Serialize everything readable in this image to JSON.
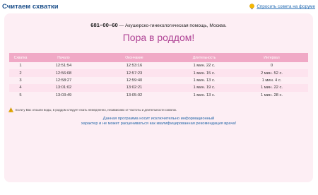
{
  "header": {
    "title": "Считаем схватки",
    "ask_link": "Спросить совета на форуме"
  },
  "panel": {
    "phone": "681−00−60",
    "phone_desc": "— Акушерско-гинекологическая помощь, Москва.",
    "headline": "Пора в роддом!",
    "columns": [
      "Схватка",
      "Начало",
      "Окончание",
      "Длительность",
      "Интервал"
    ],
    "rows": [
      [
        "1",
        "12:51:54",
        "12:53:16",
        "1 мин. 22 с.",
        "0"
      ],
      [
        "2",
        "12:56:08",
        "12:57:23",
        "1 мин. 15 с.",
        "2 мин. 52 с."
      ],
      [
        "3",
        "12:58:27",
        "12:59:40",
        "1 мин. 13 с.",
        "1 мин. 4 с."
      ],
      [
        "4",
        "13:01:02",
        "13:02:21",
        "1 мин. 19 с.",
        "1 мин. 22 с."
      ],
      [
        "5",
        "13:03:49",
        "13:05:02",
        "1 мин. 13 с.",
        "1 мин. 28 с."
      ]
    ],
    "warning": "Если у Вас отошли воды, в роддом следует ехать немедленно, независимо от частоты и длительности схваток.",
    "disclaimer_1": "Данная программа носит исключительно информационный",
    "disclaimer_2": "характер и не может расцениваться как квалифицированная рекомендация врача!"
  },
  "colors": {
    "panel_bg": "#fdeef4",
    "header_row": "#f0a9c6",
    "headline": "#b04596",
    "title": "#1c4f8a"
  }
}
